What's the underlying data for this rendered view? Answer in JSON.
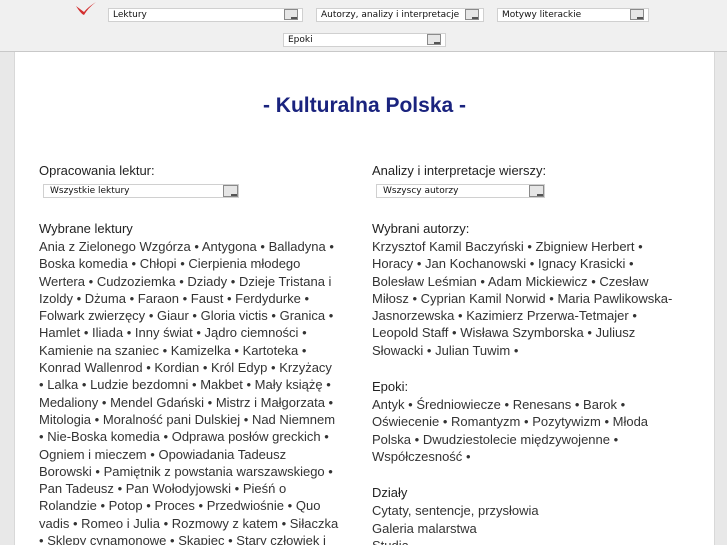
{
  "nav": {
    "select1": "Lektury",
    "select2": "Autorzy, analizy i interpretacje",
    "select3": "Motywy literackie",
    "select4": "Epoki"
  },
  "title": "- Kulturalna Polska -",
  "left": {
    "heading": "Opracowania lektur:",
    "select": "Wszystkie lektury",
    "subheading": "Wybrane lektury",
    "items": [
      "Ania z Zielonego Wzgórza",
      "Antygona",
      "Balladyna",
      "Boska komedia",
      "Chłopi",
      "Cierpienia młodego Wertera",
      "Cudzoziemka",
      "Dziady",
      "Dzieje Tristana i Izoldy",
      "Dżuma",
      "Faraon",
      "Faust",
      "Ferdydurke",
      "Folwark zwierzęcy",
      "Giaur",
      "Gloria victis",
      "Granica",
      "Hamlet",
      "Iliada",
      "Inny świat",
      "Jądro ciemności",
      "Kamienie na szaniec",
      "Kamizelka",
      "Kartoteka",
      "Konrad Wallenrod",
      "Kordian",
      "Król Edyp",
      "Krzyżacy",
      "Lalka",
      "Ludzie bezdomni",
      "Makbet",
      "Mały książę",
      "Medaliony",
      "Mendel Gdański",
      "Mistrz i Małgorzata",
      "Mitologia",
      "Moralność pani Dulskiej",
      "Nad Niemnem",
      "Nie-Boska komedia",
      "Odprawa posłów greckich",
      "Ogniem i mieczem",
      "Opowiadania Tadeusz Borowski",
      "Pamiętnik z powstania warszawskiego",
      "Pan Tadeusz",
      "Pan Wołodyjowski",
      "Pieśń o Rolandzie",
      "Potop",
      "Proces",
      "Przedwiośnie",
      "Quo vadis",
      "Romeo i Julia",
      "Rozmowy z katem",
      "Siłaczka",
      "Sklepy cynamonowe",
      "Skąpiec",
      "Stary człowiek i morze"
    ]
  },
  "right": {
    "heading": "Analizy i interpretacje wierszy:",
    "select": "Wszyscy autorzy",
    "authors_heading": "Wybrani autorzy:",
    "authors": [
      "Krzysztof Kamil Baczyński",
      "Zbigniew Herbert",
      "Horacy",
      "Jan Kochanowski",
      "Ignacy Krasicki",
      "Bolesław Leśmian",
      "Adam Mickiewicz",
      "Czesław Miłosz",
      "Cyprian Kamil Norwid",
      "Maria Pawlikowska-Jasnorzewska",
      "Kazimierz Przerwa-Tetmajer",
      "Leopold Staff",
      "Wisława Szymborska",
      "Juliusz Słowacki",
      "Julian Tuwim"
    ],
    "epochs_heading": "Epoki:",
    "epochs": [
      "Antyk",
      "Średniowiecze",
      "Renesans",
      "Barok",
      "Oświecenie",
      "Romantyzm",
      "Pozytywizm",
      "Młoda Polska",
      "Dwudziestolecie międzywojenne",
      "Współczesność"
    ],
    "sections_heading": "Działy",
    "sections": [
      "Cytaty, sentencje, przysłowia",
      "Galeria malarstwa",
      "Studia"
    ]
  },
  "separator": "•"
}
